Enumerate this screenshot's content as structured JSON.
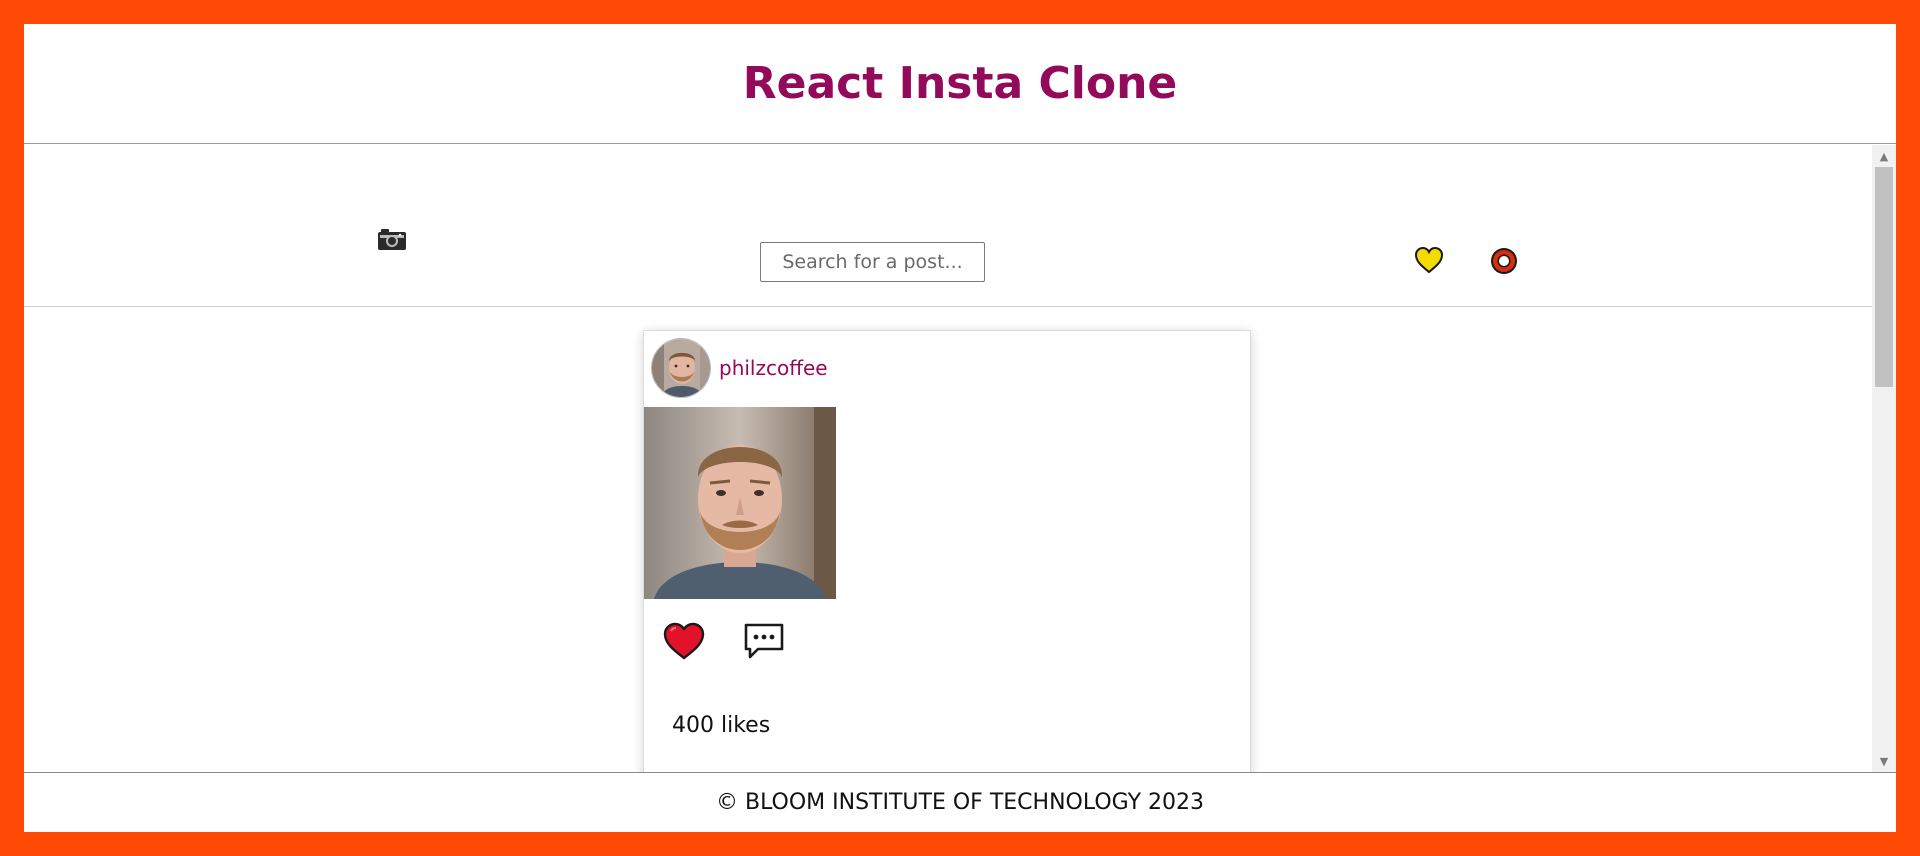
{
  "header": {
    "title": "React Insta Clone"
  },
  "search_bar": {
    "camera_icon": "camera-icon",
    "search_placeholder": "Search for a post...",
    "heart_icon": "heart-outline-icon",
    "circle_icon": "circle-icon"
  },
  "post": {
    "username": "philzcoffee",
    "likes_label": "400 likes",
    "like_icon": "heart-icon",
    "comment_icon": "comment-bubble-icon"
  },
  "footer": {
    "text": "© BLOOM INSTITUTE OF TECHNOLOGY 2023"
  },
  "colors": {
    "border_frame": "#ff4a05",
    "brand": "#930a5b",
    "heart_fill": "#f4dc00",
    "like_fill": "#e3122b",
    "circle_stroke": "#d92e0e"
  }
}
